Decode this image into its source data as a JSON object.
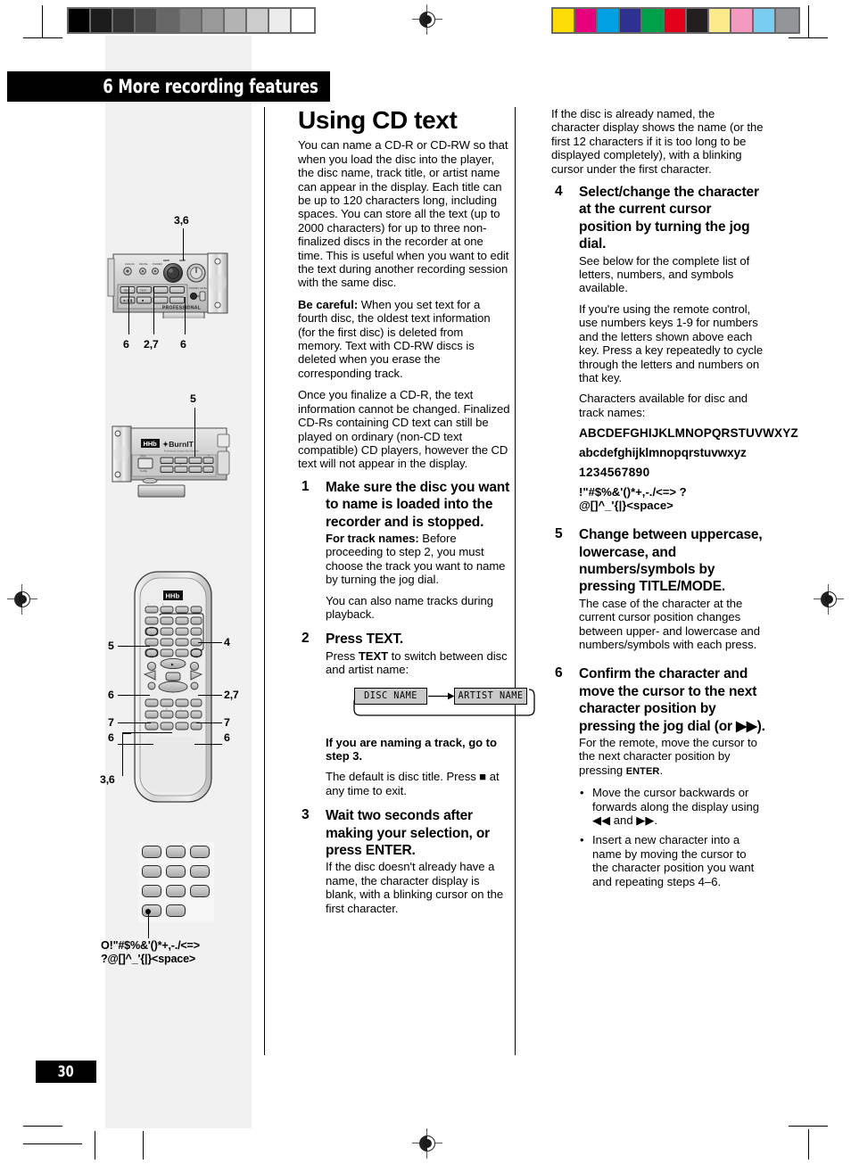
{
  "page": {
    "number": "30",
    "chapter_header": "6 More recording features"
  },
  "print_marks": {
    "grayscale_steps": [
      "#000000",
      "#1c1c1c",
      "#333333",
      "#4c4c4c",
      "#666666",
      "#808080",
      "#999999",
      "#b3b3b3",
      "#cccccc",
      "#ececec",
      "#ffffff"
    ],
    "color_steps": [
      "#fcdd06",
      "#e6007e",
      "#00a0e3",
      "#2e3192",
      "#00a04a",
      "#e3001b",
      "#231f20",
      "#fbea8a",
      "#f49ac1",
      "#78cdf0",
      "#939598"
    ]
  },
  "main": {
    "title": "Using CD text",
    "intro": "You can name a CD-R or CD-RW so that when you load the disc into the player, the disc name, track title, or artist name can appear in the display. Each title can be up to 120 characters long, including spaces. You can store all the text (up to 2000 characters) for up to three non-finalized discs in the recorder at one time. This is useful when you want to edit the text during another recording session with the same disc.",
    "be_careful_label": "Be careful:",
    "be_careful_text": " When you set text for a fourth disc, the oldest text information (for the first disc) is deleted from memory. Text with CD-RW discs is deleted when you erase the corresponding track.",
    "finalize_note": "Once you finalize a CD-R, the text information cannot be changed. Finalized CD-Rs containing CD text can still be played on ordinary (non-CD text compatible) CD players, however the CD text will not appear in the display."
  },
  "steps": [
    {
      "num": "1",
      "head": "Make sure the disc you want to name is loaded into the recorder and is stopped.",
      "sub_label": "For track names:",
      "sub_text": " Before proceeding to step 2, you must choose the track you want to name by turning the jog dial.",
      "extra": "You can also name  tracks during playback."
    },
    {
      "num": "2",
      "head": "Press TEXT.",
      "intro_a": "Press ",
      "intro_b": "TEXT",
      "intro_c": " to switch between disc and artist name:",
      "after_head": "If you are naming a track, go to step 3.",
      "after_text": "The default is disc title. Press ■ at any time to exit."
    },
    {
      "num": "3",
      "head": "Wait two seconds after making your selection, or press ENTER.",
      "body": "If the disc doesn't already have a name, the character display is blank, with a blinking cursor on the first character."
    },
    {
      "num": "4",
      "head": "Select/change the character at the current cursor position by turning the jog dial.",
      "body_1": "See below for the complete list of letters, numbers, and symbols available.",
      "body_2": "If you're using the remote control, use numbers keys 1-9 for numbers and the letters shown above each key. Press a key repeatedly to cycle through the letters and numbers on that key.",
      "body_3": "Characters available for disc and track names:"
    },
    {
      "num": "5",
      "head": "Change between uppercase, lowercase, and numbers/symbols by pressing TITLE/MODE.",
      "body": "The case of the character at the current cursor position changes between upper- and lowercase and numbers/symbols with each press."
    },
    {
      "num": "6",
      "head_a": "Confirm the character and move the cursor to the next character position by pressing the jog dial (or ",
      "head_b": "▶▶",
      "head_c": ").",
      "body_a": "For the remote, move the cursor to the next character position by pressing ",
      "body_b": "ENTER",
      "body_c": ".",
      "bullets": [
        "Move the cursor backwards or forwards along the display using ◀◀ and ▶▶.",
        "Insert a new character into a name by moving the cursor to the character position you want and repeating steps 4–6."
      ]
    }
  ],
  "right_top_note": "If the disc is already named, the character display shows the name (or the first 12 characters if it is too long to be displayed completely), with a blinking cursor under the first character.",
  "character_set": {
    "uppercase": "ABCDEFGHIJKLMNOPQRSTUVWXYZ",
    "lowercase": "abcdefghijklmnopqrstuvwxyz",
    "numbers": "1234567890",
    "symbols_line1": "!\"#$%&'()*+,-./<=> ?",
    "symbols_line2": "@[]^_'{|}<space>"
  },
  "name_flow": {
    "disc": "DISC NAME",
    "artist": "ARTIST NAME"
  },
  "figures": {
    "deck_front": {
      "brand": "PROFESSIONAL",
      "callouts_top": [
        "3,6"
      ],
      "callouts_bottom": [
        "6",
        "2,7",
        "6"
      ]
    },
    "deck_burnit": {
      "brand": "HHb",
      "model": "BurnIT",
      "callouts": [
        "5"
      ]
    },
    "remote": {
      "brand": "HHb",
      "callouts_left": [
        "5",
        "6",
        "7",
        "6",
        "3,6"
      ],
      "callouts_right": [
        "4",
        "2,7",
        "7",
        "6"
      ]
    },
    "keypad_detail": {
      "caption_line1": "O!\"#$%&'()*+,-./<=>",
      "caption_line2": "?@[]^_'{|}<space>"
    }
  }
}
